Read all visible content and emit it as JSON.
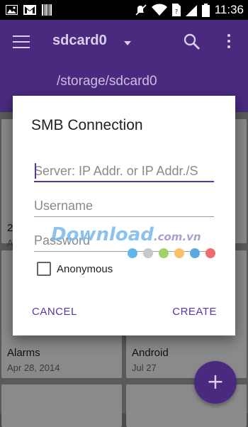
{
  "status_bar": {
    "time": "11:36",
    "left_icons": [
      "image-icon",
      "gmail-icon",
      "barcode-icon"
    ],
    "right_icons": [
      "mute-icon",
      "wifi-icon",
      "sim-icon",
      "signal-icon",
      "battery-icon"
    ]
  },
  "app_bar": {
    "title": "sdcard0",
    "path": "/storage/sdcard0",
    "background_color": "#4a2a7e"
  },
  "background_cards": [
    {
      "name": "Alarms",
      "date": "Apr 28, 2014"
    },
    {
      "name": "Android",
      "date": "Jul 27"
    }
  ],
  "partial_card": {
    "name_fragment": "2",
    "date_fragment": "A"
  },
  "dialog": {
    "title": "SMB Connection",
    "server": {
      "value": "",
      "placeholder": "Server: IP Addr. or IP Addr./S"
    },
    "username": {
      "value": "",
      "placeholder": "Username"
    },
    "password": {
      "value": "",
      "placeholder": "Password"
    },
    "anonymous": {
      "label": "Anonymous",
      "checked": false
    },
    "cancel_label": "CANCEL",
    "create_label": "CREATE",
    "accent_color": "#5a35a6"
  },
  "fab": {
    "icon": "plus-icon",
    "label": "+"
  },
  "watermark": {
    "text": "Download",
    "suffix": ".com.vn",
    "dot_colors": [
      "#5fb7ea",
      "#c8c8c8",
      "#9fd36a",
      "#f7c26a",
      "#5aa9e0",
      "#ef6b6b"
    ]
  }
}
